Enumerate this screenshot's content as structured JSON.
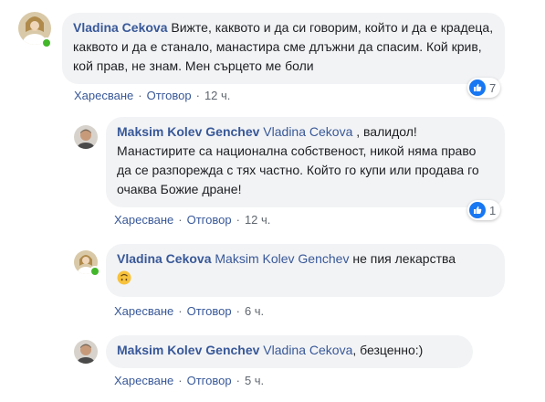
{
  "comments": [
    {
      "author": "Vladina Cekova",
      "text": "Вижте, каквото и да си говорим, който и да е крадеца, каквото и да е станало, манастира сме длъжни да спасим. Кой крив, кой прав, не знам. Мен сърцето ме боли",
      "actions": {
        "like": "Харесване",
        "reply": "Отговор",
        "time": "12 ч."
      },
      "reaction_count": "7",
      "online": true
    },
    {
      "author": "Maksim Kolev Genchev",
      "tag": "Vladina Cekova",
      "text": ", валидол! Манастирите са национална собственост, никой няма право да се разпорежда с тях частно. Който го купи или продава го очаква Божие дране!",
      "actions": {
        "like": "Харесване",
        "reply": "Отговор",
        "time": "12 ч."
      },
      "reaction_count": "1"
    },
    {
      "author": "Vladina Cekova",
      "tag": "Maksim Kolev Genchev",
      "text": "не пия лекарства",
      "emoji": "upside-down-face-icon",
      "actions": {
        "like": "Харесване",
        "reply": "Отговор",
        "time": "6 ч."
      },
      "online": true
    },
    {
      "author": "Maksim Kolev Genchev",
      "tag": "Vladina Cekova",
      "text": ", безценно:)",
      "actions": {
        "like": "Харесване",
        "reply": "Отговор",
        "time": "5 ч."
      }
    }
  ],
  "colors": {
    "author": "#385898",
    "bubble": "#f2f3f5",
    "meta": "#606770",
    "like": "#1877f2",
    "online": "#42b72a"
  }
}
